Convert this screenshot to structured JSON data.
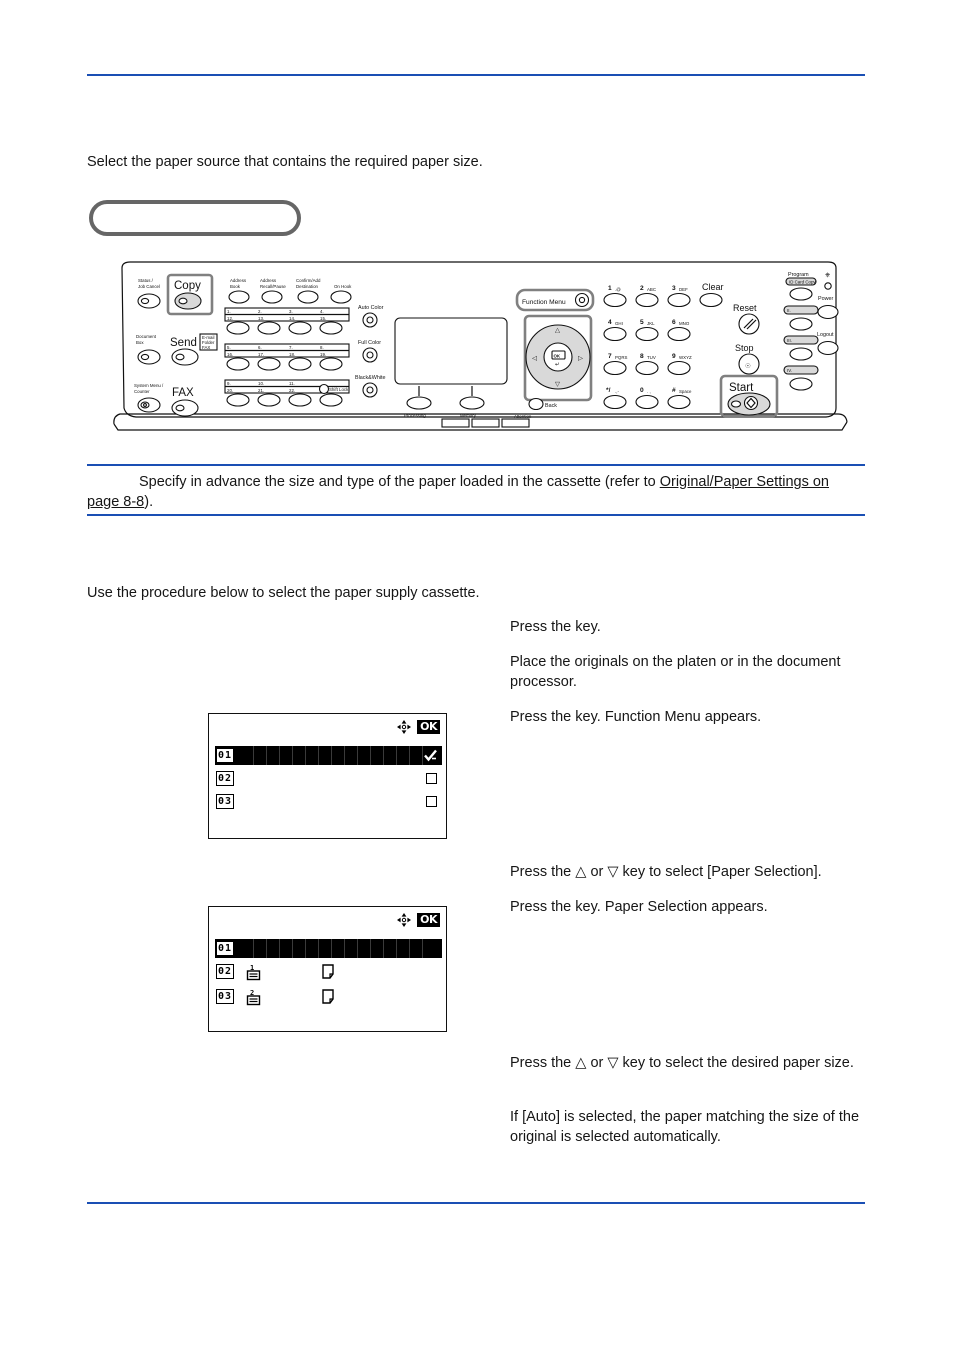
{
  "page": {
    "intro": "Select the paper source that contains the required paper size.",
    "procedure_intro": "Use the procedure below to select the paper supply cassette.",
    "rule_color": "#1a4fb4"
  },
  "note": {
    "text_before_link": "Specify in advance the size and type of the paper loaded in the cassette (refer to ",
    "link_text": "Original/Paper Settings on page 8-8",
    "text_after_link": ")."
  },
  "steps": [
    {
      "id": "step1",
      "text": "Press the          key."
    },
    {
      "id": "step2",
      "text": "Place the originals on the platen or in the document processor."
    },
    {
      "id": "step3",
      "text": "Press the                       key. Function Menu appears."
    },
    {
      "id": "step4",
      "text": "Press the △ or ▽ key to select [Paper Selection]."
    },
    {
      "id": "step5",
      "text": "Press the      key. Paper Selection appears."
    },
    {
      "id": "step6",
      "text": "Press the △ or ▽ key to select the desired paper size."
    },
    {
      "id": "step7",
      "text": "If [Auto] is selected, the paper matching the size of the original is selected automatically."
    }
  ],
  "lcd_screens": [
    {
      "name": "function-menu-screen",
      "ok_label": "OK",
      "nav_icon": "four-way-arrow-icon",
      "rows": [
        {
          "num": "01",
          "selected": true,
          "right_icon": "checkmark-icon"
        },
        {
          "num": "02",
          "selected": false,
          "right_icon": "checkbox-icon"
        },
        {
          "num": "03",
          "selected": false,
          "right_icon": "checkbox-icon"
        }
      ]
    },
    {
      "name": "paper-selection-screen",
      "ok_label": "OK",
      "nav_icon": "four-way-arrow-icon",
      "rows": [
        {
          "num": "01",
          "selected": true,
          "cassette": "",
          "sheet": false
        },
        {
          "num": "02",
          "selected": false,
          "cassette": "1",
          "sheet": true
        },
        {
          "num": "03",
          "selected": false,
          "cassette": "2",
          "sheet": true
        }
      ]
    }
  ],
  "control_panel": {
    "labels": {
      "status_job_cancel": "Status /\nJob Cancel",
      "copy": "Copy",
      "document_box": "Document\nBox",
      "send": "Send",
      "send_sub": "E-mail\nFolder\nFAX",
      "system_menu_counter": "System Menu /\nCounter",
      "fax": "FAX",
      "address_book": "Address\nBook",
      "address_recall_pause": "Address\nRecall/Pause",
      "confirm_add_destination": "Confirm/Add\nDestination",
      "on_hook": "On Hook",
      "shift_lock": "Shift Lock",
      "auto_color": "Auto Color",
      "full_color": "Full Color",
      "black_white": "Black&White",
      "processing": "Processing",
      "memory": "Memory",
      "attention": "Attention",
      "function_menu": "Function Menu",
      "back": "Back",
      "ok": "OK",
      "clear": "Clear",
      "reset": "Reset",
      "stop": "Stop",
      "start": "Start",
      "program": "Program",
      "id_card_copy": "ID Card Copy",
      "power": "Power",
      "logout": "Logout"
    },
    "numeric_keys": [
      {
        "digit": "1",
        "sub": ".@"
      },
      {
        "digit": "2",
        "sub": "ABC"
      },
      {
        "digit": "3",
        "sub": "DEF"
      },
      {
        "digit": "4",
        "sub": "GHI"
      },
      {
        "digit": "5",
        "sub": "JKL"
      },
      {
        "digit": "6",
        "sub": "MNO"
      },
      {
        "digit": "7",
        "sub": "PQRS"
      },
      {
        "digit": "8",
        "sub": "TUV"
      },
      {
        "digit": "9",
        "sub": "WXYZ"
      },
      {
        "digit": "*/",
        "sub": ".,-"
      },
      {
        "digit": "0",
        "sub": ". ,"
      },
      {
        "digit": "#",
        "sub": "Space"
      }
    ],
    "one_touch_rows": [
      [
        "1.",
        "2.",
        "3.",
        "4.",
        "12.",
        "13.",
        "14.",
        "15."
      ],
      [
        "5.",
        "6.",
        "7.",
        "8.",
        "16.",
        "17.",
        "18.",
        "19."
      ],
      [
        "9.",
        "10.",
        "11.",
        "20.",
        "21.",
        "22."
      ]
    ],
    "highlighted_keys": [
      "copy",
      "function-menu",
      "cursor-pad",
      "start"
    ]
  }
}
